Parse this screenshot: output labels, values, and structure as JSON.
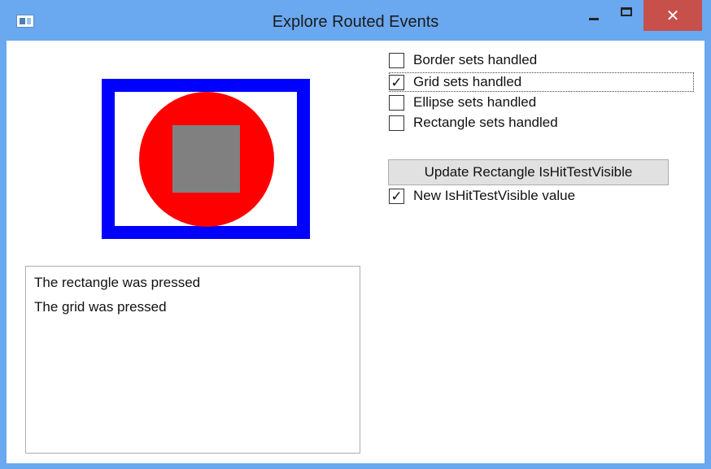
{
  "window": {
    "title": "Explore Routed Events",
    "close_glyph": "✕"
  },
  "checkboxes": [
    {
      "label": "Border sets handled",
      "checked": false
    },
    {
      "label": "Grid sets handled",
      "checked": true
    },
    {
      "label": "Ellipse sets handled",
      "checked": false
    },
    {
      "label": "Rectangle sets handled",
      "checked": false
    }
  ],
  "update_button": {
    "label": "Update Rectangle IsHitTestVisible"
  },
  "hit_test_checkbox": {
    "label": "New IsHitTestVisible value",
    "checked": true
  },
  "check_glyph": "✓",
  "log": {
    "items": [
      "The rectangle was pressed",
      "The grid was pressed"
    ]
  },
  "colors": {
    "border_shape": "#0000ff",
    "ellipse_shape": "#ff0000",
    "rectangle_shape": "#808080",
    "titlebar": "#6aa8f0",
    "close_button": "#c7504a"
  }
}
